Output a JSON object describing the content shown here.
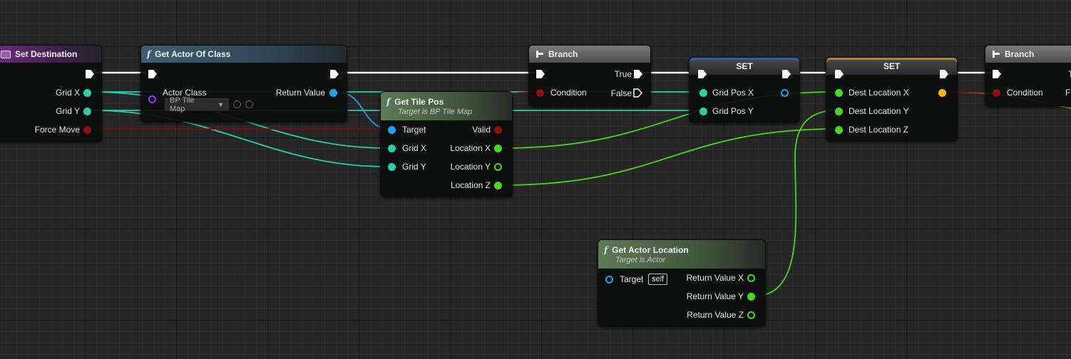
{
  "colors": {
    "exec": "#ffffff",
    "int": "#28d0a9",
    "object": "#1aa4ee",
    "bool": "#8f0f0f",
    "float": "#4ad81c",
    "vector_gold": "#f0b81a",
    "class": "#8a3cff"
  },
  "nodes": {
    "set_destination": {
      "title": "Set Destination",
      "icon": "event-icon",
      "pins": {
        "grid_x": "Grid X",
        "grid_y": "Grid Y",
        "force_move": "Force Move"
      }
    },
    "get_actor_of_class": {
      "title": "Get Actor Of Class",
      "icon": "function-icon",
      "pins": {
        "actor_class": "Actor Class",
        "return_value": "Return Value"
      },
      "class_select": "BP Tile Map"
    },
    "get_tile_pos": {
      "title": "Get Tile Pos",
      "subtitle": "Target is BP Tile Map",
      "icon": "function-icon",
      "pins": {
        "target": "Target",
        "grid_x": "Grid X",
        "grid_y": "Grid Y",
        "valid": "Valid",
        "location_x": "Location X",
        "location_y": "Location Y",
        "location_z": "Location Z"
      }
    },
    "branch_1": {
      "title": "Branch",
      "icon": "branch-icon",
      "pins": {
        "condition": "Condition",
        "true": "True",
        "false": "False"
      }
    },
    "set_grid_pos": {
      "title": "SET",
      "pins": {
        "grid_pos_x": "Grid Pos X",
        "grid_pos_y": "Grid Pos Y"
      }
    },
    "set_dest_location": {
      "title": "SET",
      "pins": {
        "x": "Dest Location X",
        "y": "Dest Location Y",
        "z": "Dest Location Z"
      }
    },
    "branch_2": {
      "title": "Branch",
      "icon": "branch-icon",
      "pins": {
        "condition": "Condition",
        "true_partial": "T",
        "false_partial": "F"
      }
    },
    "get_actor_location": {
      "title": "Get Actor Location",
      "subtitle": "Target is Actor",
      "icon": "function-icon",
      "self_label": "self",
      "pins": {
        "target": "Target",
        "rx": "Return Value X",
        "ry": "Return Value Y",
        "rz": "Return Value Z"
      }
    }
  }
}
